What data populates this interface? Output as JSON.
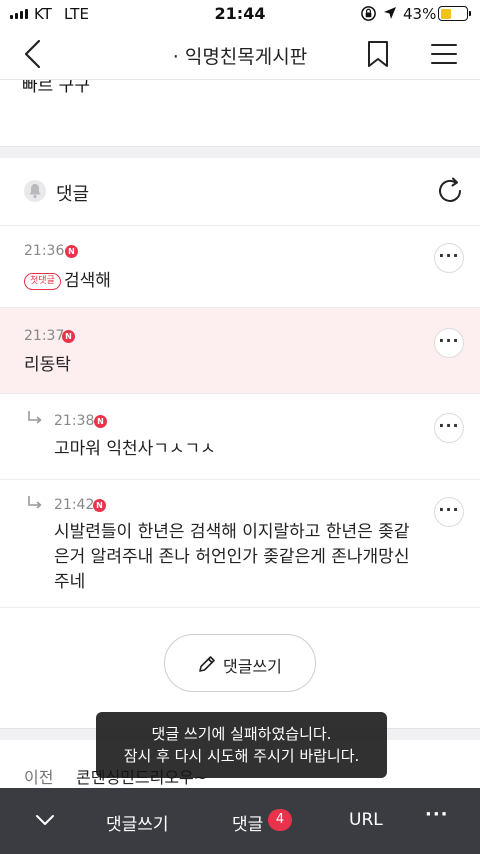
{
  "status_bar": {
    "carrier": "KT",
    "network": "LTE",
    "time": "21:44",
    "battery_percent": "43%",
    "battery_level": 0.43,
    "battery_color": "#f2c21b"
  },
  "header": {
    "title": "· 익명친목게시판",
    "back_icon": "back-chevron-icon",
    "bookmark_icon": "bookmark-icon",
    "menu_icon": "hamburger-menu-icon"
  },
  "post": {
    "clipped_text": "빠르 구구"
  },
  "comments_section": {
    "label": "댓글",
    "bell_icon": "bell-icon",
    "refresh_icon": "refresh-icon",
    "badge_letter": "N",
    "first_comment_tag": "첫댓글",
    "more_label": "···",
    "highlight_color": "#fdeef0",
    "accent_color": "#e8334a",
    "comments": [
      {
        "time": "21:36",
        "text": "검색해",
        "first": true,
        "reply": false,
        "highlighted": false
      },
      {
        "time": "21:37",
        "text": "리동탁",
        "first": false,
        "reply": false,
        "highlighted": true
      },
      {
        "time": "21:38",
        "text": "고마워 익천사ㄱㅅㄱㅅ",
        "first": false,
        "reply": true,
        "highlighted": false
      },
      {
        "time": "21:42",
        "text_lines": [
          "시발련들이 한년은 검색해 이지랄하고 한년은 좆같",
          "은거 알려주내 존나 허언인가 좆같은게 존나개망신",
          "주네"
        ],
        "first": false,
        "reply": true,
        "highlighted": false
      }
    ]
  },
  "write_button": {
    "label": "댓글쓰기",
    "icon": "pencil-icon"
  },
  "prev_post": {
    "label": "이전",
    "title": "콘덴싱민드리오우~"
  },
  "toast": {
    "line1": "댓글 쓰기에 실패하였습니다.",
    "line2": "잠시 후 다시 시도해 주시기 바랍니다."
  },
  "bottom_bar": {
    "collapse_icon": "chevron-down-icon",
    "write_label": "댓글쓰기",
    "comments_label": "댓글",
    "comment_count": "4",
    "url_label": "URL",
    "more_label": "···"
  }
}
